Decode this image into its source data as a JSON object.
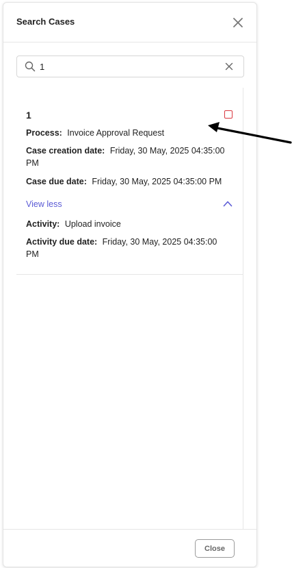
{
  "panel": {
    "title": "Search Cases"
  },
  "search": {
    "value": "1",
    "placeholder": ""
  },
  "result": {
    "case_number": "1",
    "process_label": "Process:",
    "process_value": "Invoice Approval Request",
    "creation_label": "Case creation date:",
    "creation_value": "Friday, 30 May, 2025 04:35:00 PM",
    "due_label": "Case due date:",
    "due_value": "Friday, 30 May, 2025 04:35:00 PM",
    "toggle_label": "View less",
    "activity_label": "Activity:",
    "activity_value": "Upload invoice",
    "activity_due_label": "Activity due date:",
    "activity_due_value": "Friday, 30 May, 2025 04:35:00 PM"
  },
  "footer": {
    "close_label": "Close"
  },
  "colors": {
    "accent": "#5b5bd6",
    "checkbox_border": "#d9363e",
    "annotation_arrow": "#000000"
  },
  "icons": [
    "close-icon",
    "search-icon",
    "clear-icon",
    "chevron-up-icon"
  ]
}
